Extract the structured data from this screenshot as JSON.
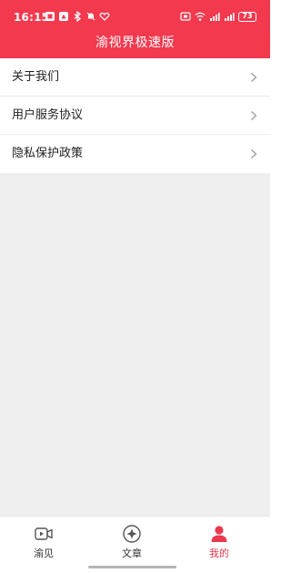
{
  "status_bar": {
    "time": "16:15",
    "battery": "73"
  },
  "header": {
    "title": "渝视界极速版"
  },
  "menu": {
    "items": [
      {
        "label": "关于我们",
        "icon": "chevron-right-icon"
      },
      {
        "label": "用户服务协议",
        "icon": "chevron-right-icon"
      },
      {
        "label": "隐私保护政策",
        "icon": "chevron-right-icon"
      }
    ]
  },
  "bottom_nav": {
    "items": [
      {
        "label": "渝见",
        "icon": "video-icon",
        "active": false
      },
      {
        "label": "文章",
        "icon": "compass-icon",
        "active": false
      },
      {
        "label": "我的",
        "icon": "person-icon",
        "active": true
      }
    ]
  },
  "colors": {
    "brand": "#f2394e",
    "active_tab": "#e83a4c",
    "background": "#efefef"
  }
}
